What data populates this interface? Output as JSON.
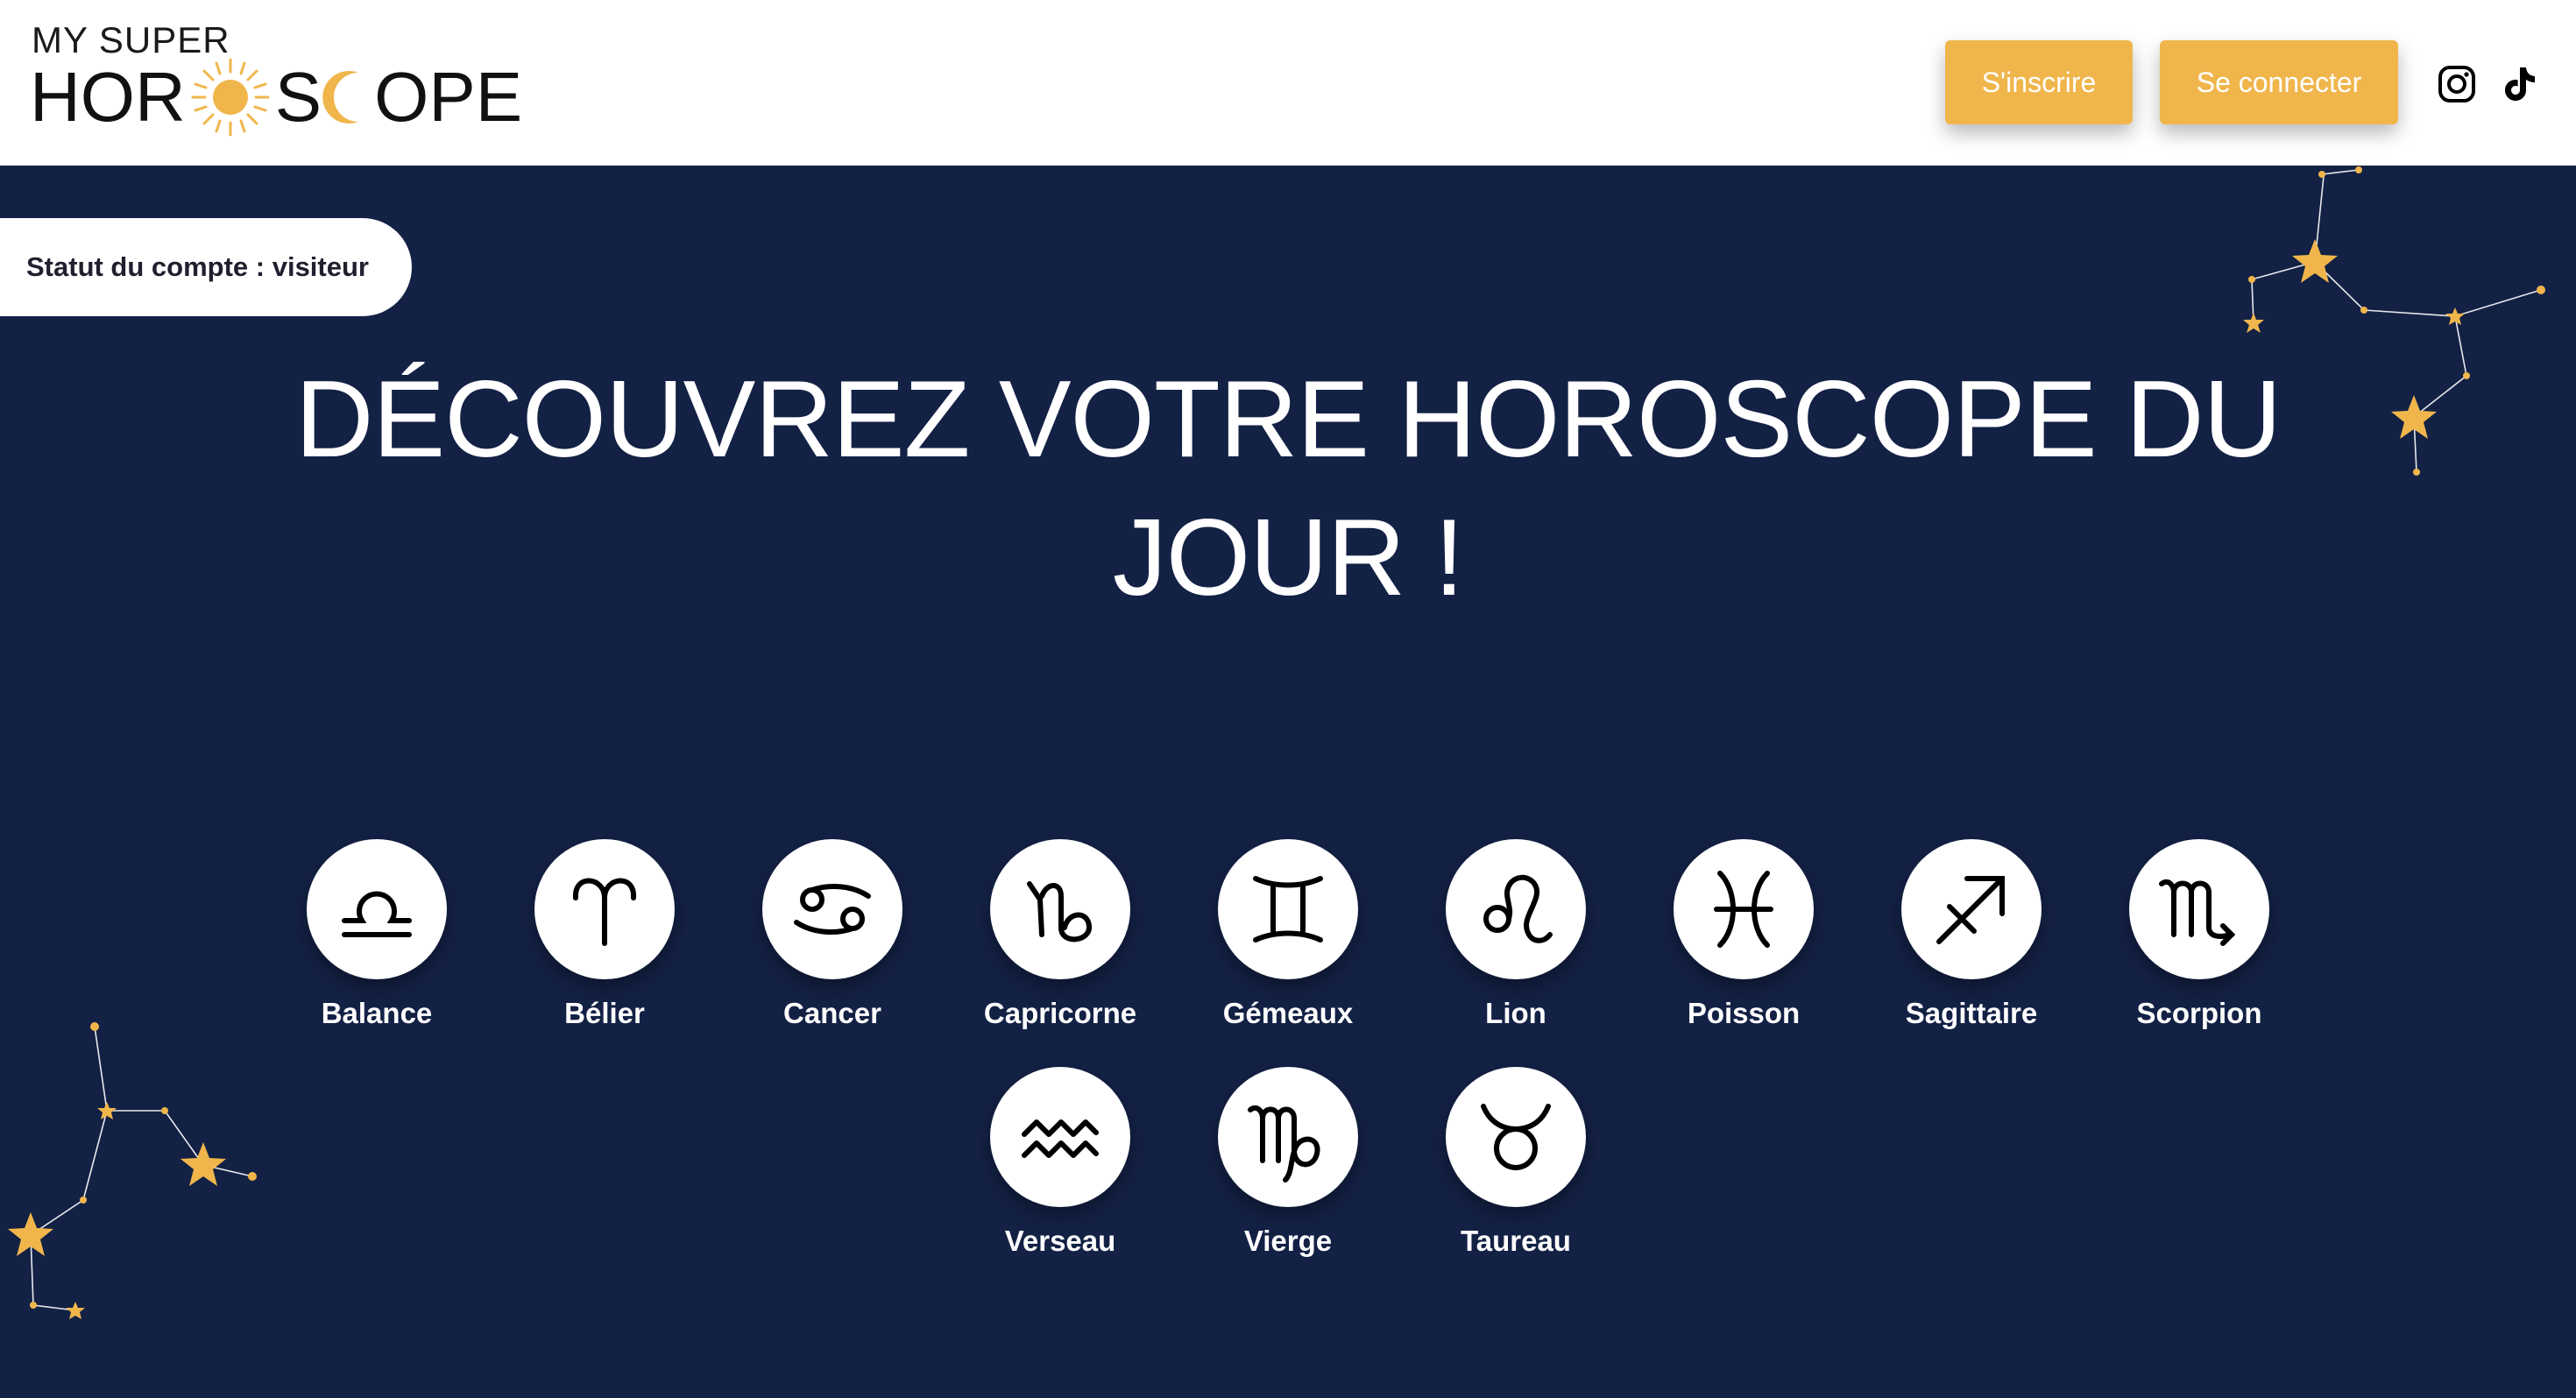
{
  "header": {
    "logo_top": "MY SUPER",
    "logo_part1": "HOR",
    "logo_part2": "S",
    "logo_part3": "OPE",
    "signup_label": "S'inscrire",
    "login_label": "Se connecter",
    "social_icons": [
      "instagram-icon",
      "tiktok-icon"
    ]
  },
  "account": {
    "status_text": "Statut du compte : visiteur"
  },
  "hero": {
    "title": "DÉCOUVREZ VOTRE HOROSCOPE DU JOUR !"
  },
  "signs": [
    {
      "label": "Balance",
      "icon": "libra-icon"
    },
    {
      "label": "Bélier",
      "icon": "aries-icon"
    },
    {
      "label": "Cancer",
      "icon": "cancer-icon"
    },
    {
      "label": "Capricorne",
      "icon": "capricorn-icon"
    },
    {
      "label": "Gémeaux",
      "icon": "gemini-icon"
    },
    {
      "label": "Lion",
      "icon": "leo-icon"
    },
    {
      "label": "Poisson",
      "icon": "pisces-icon"
    },
    {
      "label": "Sagittaire",
      "icon": "sagittarius-icon"
    },
    {
      "label": "Scorpion",
      "icon": "scorpio-icon"
    },
    {
      "label": "Verseau",
      "icon": "aquarius-icon"
    },
    {
      "label": "Vierge",
      "icon": "virgo-icon"
    },
    {
      "label": "Taureau",
      "icon": "taurus-icon"
    }
  ],
  "colors": {
    "background": "#132145",
    "accent": "#f0b64c",
    "header_bg": "#ffffff",
    "text_light": "#ffffff"
  }
}
